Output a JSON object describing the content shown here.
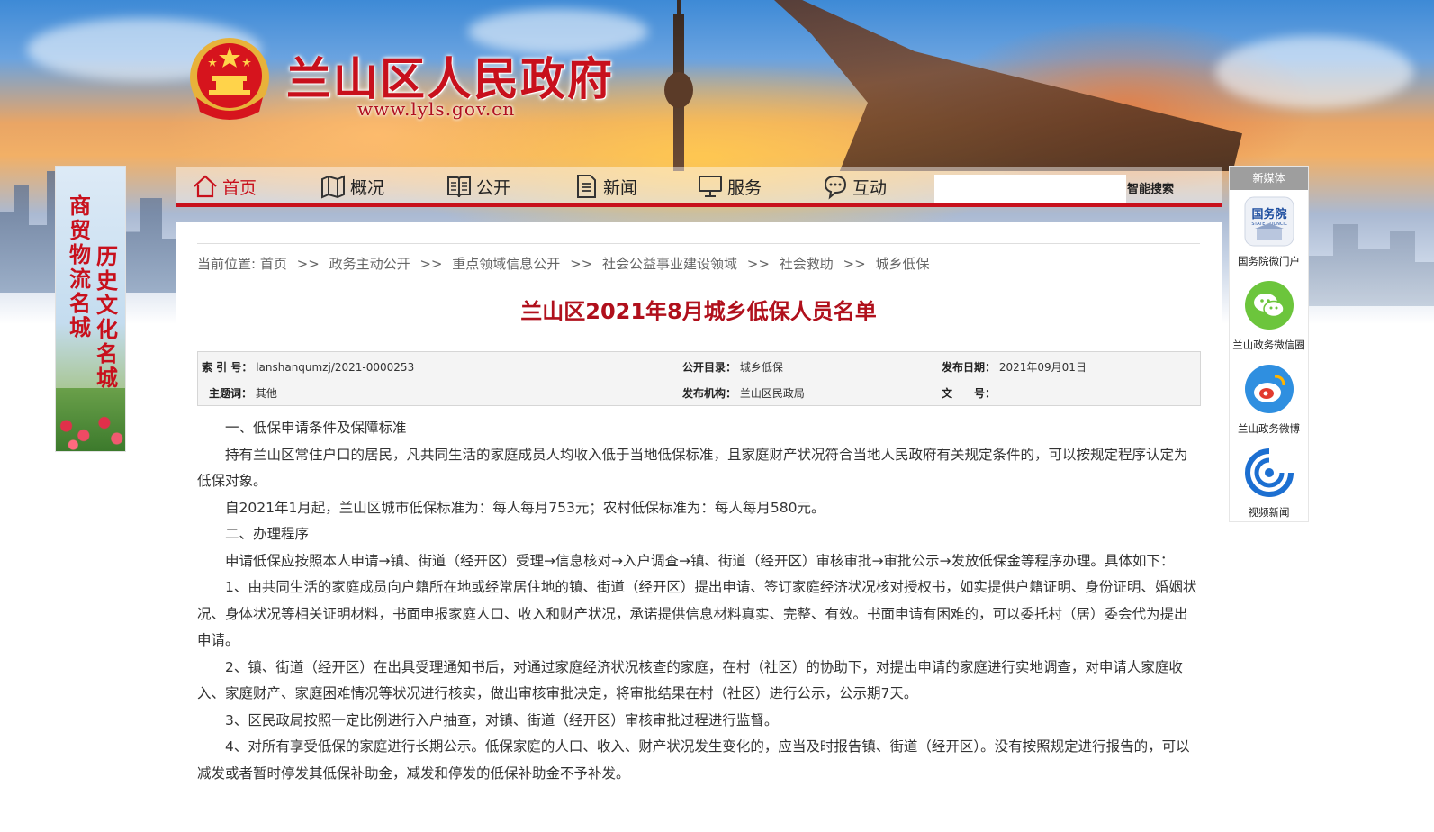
{
  "site": {
    "title": "兰山区人民政府",
    "url": "www.lyls.gov.cn"
  },
  "left_banner": {
    "col1": "商贸物流名城",
    "col2": "历史文化名城"
  },
  "nav": {
    "items": [
      {
        "label": "首页",
        "icon": "home-icon"
      },
      {
        "label": "概况",
        "icon": "map-icon"
      },
      {
        "label": "公开",
        "icon": "book-icon"
      },
      {
        "label": "新闻",
        "icon": "document-icon"
      },
      {
        "label": "服务",
        "icon": "monitor-icon"
      },
      {
        "label": "互动",
        "icon": "chat-icon"
      }
    ],
    "search_value": "",
    "search_button": "智能搜索"
  },
  "media": {
    "heading": "新媒体",
    "items": [
      {
        "label": "国务院微门户",
        "icon": "state-council-icon",
        "icon_text": "国务院",
        "icon_sub": "STATE COUNCIL"
      },
      {
        "label": "兰山政务微信圈",
        "icon": "wechat-icon"
      },
      {
        "label": "兰山政务微博",
        "icon": "weibo-icon"
      },
      {
        "label": "视频新闻",
        "icon": "video-news-icon"
      }
    ]
  },
  "breadcrumb": {
    "prefix": "当前位置:",
    "items": [
      "首页",
      "政务主动公开",
      "重点领域信息公开",
      "社会公益事业建设领域",
      "社会救助",
      "城乡低保"
    ],
    "separator": ">>"
  },
  "article": {
    "title": "兰山区2021年8月城乡低保人员名单",
    "meta": {
      "index_label": "索 引 号：",
      "index_value": "lanshanqumzj/2021-0000253",
      "catalog_label": "公开目录：",
      "catalog_value": "城乡低保",
      "date_label": "发布日期：",
      "date_value": "2021年09月01日",
      "topic_label": "主题词：",
      "topic_value": "其他",
      "org_label": "发布机构：",
      "org_value": "兰山区民政局",
      "docno_label": "文　　号：",
      "docno_value": ""
    },
    "paragraphs": [
      "一、低保申请条件及保障标准",
      "持有兰山区常住户口的居民，凡共同生活的家庭成员人均收入低于当地低保标准，且家庭财产状况符合当地人民政府有关规定条件的，可以按规定程序认定为低保对象。",
      "自2021年1月起，兰山区城市低保标准为：每人每月753元；农村低保标准为：每人每月580元。",
      "二、办理程序",
      "申请低保应按照本人申请→镇、街道（经开区）受理→信息核对→入户调查→镇、街道（经开区）审核审批→审批公示→发放低保金等程序办理。具体如下：",
      "1、由共同生活的家庭成员向户籍所在地或经常居住地的镇、街道（经开区）提出申请、签订家庭经济状况核对授权书，如实提供户籍证明、身份证明、婚姻状况、身体状况等相关证明材料，书面申报家庭人口、收入和财产状况，承诺提供信息材料真实、完整、有效。书面申请有困难的，可以委托村（居）委会代为提出申请。",
      "2、镇、街道（经开区）在出具受理通知书后，对通过家庭经济状况核查的家庭，在村（社区）的协助下，对提出申请的家庭进行实地调查，对申请人家庭收入、家庭财产、家庭困难情况等状况进行核实，做出审核审批决定，将审批结果在村（社区）进行公示，公示期7天。",
      "3、区民政局按照一定比例进行入户抽查，对镇、街道（经开区）审核审批过程进行监督。",
      "4、对所有享受低保的家庭进行长期公示。低保家庭的人口、收入、财产状况发生变化的，应当及时报告镇、街道（经开区）。没有按照规定进行报告的，可以减发或者暂时停发其低保补助金，减发和停发的低保补助金不予补发。"
    ]
  },
  "colors": {
    "brand_red": "#c8101c",
    "title_red": "#b0101c",
    "text": "#333333"
  }
}
